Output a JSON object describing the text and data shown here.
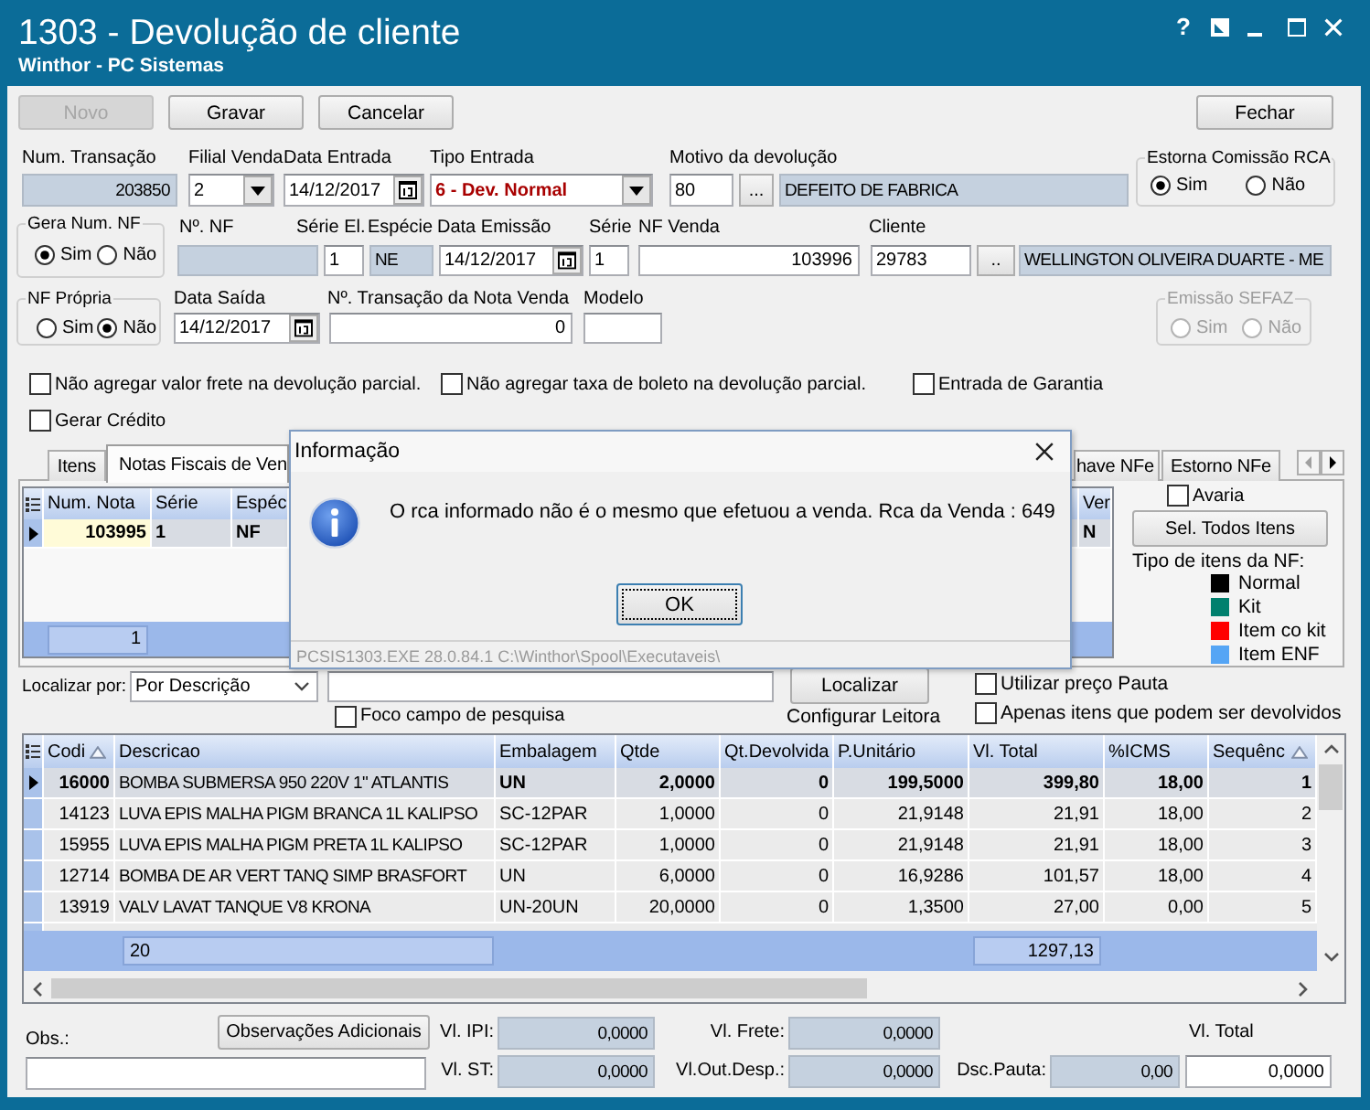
{
  "window": {
    "title": "1303 - Devolução de cliente",
    "subtitle": "Winthor - PC Sistemas",
    "controls": [
      {
        "kind": "help",
        "label": "?"
      },
      {
        "kind": "layout"
      },
      {
        "kind": "minimize"
      },
      {
        "kind": "maximize"
      },
      {
        "kind": "close"
      }
    ]
  },
  "toolbar": [
    {
      "label": "Novo",
      "disabled": true
    },
    {
      "label": "Gravar",
      "disabled": false
    },
    {
      "label": "Cancelar",
      "disabled": false
    },
    {
      "label": "Fechar",
      "disabled": false
    }
  ],
  "form_row_1": [
    {
      "kind": "readonly",
      "label": "Num. Transação",
      "value": "203850"
    },
    {
      "kind": "combo",
      "label": "Filial Venda",
      "value": "2"
    },
    {
      "kind": "date",
      "label": "Data Entrada",
      "value": "14/12/2017"
    },
    {
      "kind": "combo",
      "label": "Tipo Entrada",
      "value": "6 - Dev. Normal"
    },
    {
      "kind": "input",
      "label": "Motivo da devolução",
      "value": "80"
    },
    {
      "kind": "button",
      "value": "..."
    },
    {
      "kind": "readonly",
      "value": "DEFEITO DE FABRICA"
    }
  ],
  "estorna_comissao": {
    "title": "Estorna Comissão RCA",
    "disabled": false,
    "options": [
      {
        "label": "Sim",
        "selected": true
      },
      {
        "label": "Não",
        "selected": false
      }
    ]
  },
  "gera_num_nf": {
    "title": "Gera Num. NF",
    "disabled": false,
    "options": [
      {
        "label": "Sim",
        "selected": true
      },
      {
        "label": "Não",
        "selected": false
      }
    ]
  },
  "form_row_2": [
    {
      "kind": "readonly",
      "label": "Nº. NF"
    },
    {
      "kind": "input",
      "label": "Série El.",
      "value": "1"
    },
    {
      "kind": "readonly",
      "label": "Espécie",
      "value": "NE"
    },
    {
      "kind": "date",
      "label": "Data Emissão",
      "value": "14/12/2017"
    },
    {
      "kind": "input",
      "label": "Série",
      "value": "1"
    },
    {
      "kind": "input",
      "label": "NF Venda",
      "value": "103996"
    },
    {
      "kind": "input",
      "label": "Cliente",
      "value": "29783"
    },
    {
      "kind": "button",
      "value": ".."
    },
    {
      "kind": "readonly",
      "value": "WELLINGTON OLIVEIRA DUARTE - ME"
    }
  ],
  "nf_propria": {
    "title": "NF Própria",
    "disabled": false,
    "options": [
      {
        "label": "Sim",
        "selected": false
      },
      {
        "label": "Não",
        "selected": true
      }
    ]
  },
  "form_row_3": [
    {
      "kind": "date",
      "label": "Data Saída",
      "value": "14/12/2017"
    },
    {
      "kind": "input",
      "label": "Nº. Transação da Nota Venda",
      "value": "0"
    },
    {
      "kind": "input",
      "label": "Modelo"
    }
  ],
  "emissao_sefaz": {
    "title": "Emissão SEFAZ",
    "disabled": true,
    "options": [
      {
        "label": "Sim",
        "selected": false
      },
      {
        "label": "Não",
        "selected": false
      }
    ]
  },
  "checkboxes": [
    {
      "label": "Não agregar valor frete na devolução parcial.",
      "checked": false
    },
    {
      "label": "Não agregar taxa de boleto na devolução parcial.",
      "checked": false
    },
    {
      "label": "Entrada de Garantia",
      "checked": false
    },
    {
      "label": "Gerar Crédito",
      "checked": false
    }
  ],
  "tabs": [
    {
      "label": "Itens",
      "selected": false
    },
    {
      "label": "Notas Fiscais de Ven",
      "selected": true
    },
    {
      "label": "have NFe",
      "selected": false
    },
    {
      "label": "Estorno NFe",
      "selected": false
    }
  ],
  "invoice_grid": {
    "columns": [
      "Num. Nota",
      "Série",
      "Espéc",
      "Ver"
    ],
    "rows": [
      {
        "selected": true,
        "cells": [
          "103995",
          "1",
          "NF",
          "N"
        ]
      }
    ],
    "footer": "1"
  },
  "avaria": {
    "label": "Avaria",
    "checked": false
  },
  "select_all_button": "Sel. Todos Itens",
  "legend": {
    "title": "Tipo de itens da NF:",
    "items": [
      {
        "label": "Normal",
        "color": "#000000"
      },
      {
        "label": "Kit",
        "color": "#00806e"
      },
      {
        "label": "Item co kit",
        "color": "#ff0000"
      },
      {
        "label": "Item ENF",
        "color": "#55a5f5"
      }
    ]
  },
  "search": {
    "label": "Localizar por:",
    "mode": "Por Descrição",
    "button": "Localizar",
    "focus_option": {
      "label": "Foco campo de pesquisa",
      "checked": false
    },
    "reader_link": "Configurar Leitora"
  },
  "filters": [
    {
      "label": "Utilizar preço Pauta",
      "checked": false
    },
    {
      "label": "Apenas itens que podem ser devolvidos",
      "checked": false
    }
  ],
  "items_table": {
    "columns": [
      {
        "label": "Codi",
        "sorted": true
      },
      {
        "label": "Descricao",
        "sorted": false
      },
      {
        "label": "Embalagem",
        "sorted": false
      },
      {
        "label": "Qtde",
        "sorted": false
      },
      {
        "label": "Qt.Devolvida",
        "sorted": false
      },
      {
        "label": "P.Unitário",
        "sorted": false
      },
      {
        "label": "Vl. Total",
        "sorted": false
      },
      {
        "label": "%ICMS",
        "sorted": false
      },
      {
        "label": "Sequênc",
        "sorted": true
      }
    ],
    "rows": [
      {
        "selected": true,
        "cells": [
          "16000",
          "BOMBA SUBMERSA 950 220V 1\" ATLANTIS",
          "UN",
          "2,0000",
          "0",
          "199,5000",
          "399,80",
          "18,00",
          "1"
        ]
      },
      {
        "selected": false,
        "cells": [
          "14123",
          "LUVA EPIS MALHA PIGM BRANCA 1L KALIPSO",
          "SC-12PAR",
          "1,0000",
          "0",
          "21,9148",
          "21,91",
          "18,00",
          "2"
        ]
      },
      {
        "selected": false,
        "cells": [
          "15955",
          "LUVA EPIS MALHA PIGM PRETA 1L KALIPSO",
          "SC-12PAR",
          "1,0000",
          "0",
          "21,9148",
          "21,91",
          "18,00",
          "3"
        ]
      },
      {
        "selected": false,
        "cells": [
          "12714",
          "BOMBA DE AR VERT TANQ SIMP BRASFORT",
          "UN",
          "6,0000",
          "0",
          "16,9286",
          "101,57",
          "18,00",
          "4"
        ]
      },
      {
        "selected": false,
        "cells": [
          "13919",
          "VALV LAVAT TANQUE V8 KRONA",
          "UN-20UN",
          "20,0000",
          "0",
          "1,3500",
          "27,00",
          "0,00",
          "5"
        ]
      }
    ],
    "footer": {
      "count": "20",
      "total": "1297,13"
    }
  },
  "notes_button": "Observações Adicionais",
  "obs": {
    "label": "Obs.:"
  },
  "totals": [
    {
      "label": "Vl. IPI:",
      "value": "0,0000"
    },
    {
      "label": "Vl. Frete:",
      "value": "0,0000"
    },
    {
      "label": "Vl. ST:",
      "value": "0,0000"
    },
    {
      "label": "Vl.Out.Desp.:",
      "value": "0,0000"
    },
    {
      "label": "Dsc.Pauta:",
      "value": "0,00"
    }
  ],
  "grand_total": {
    "label": "Vl. Total",
    "value": "0,0000"
  },
  "dialog": {
    "title": "Informação",
    "message": "O rca informado não é o mesmo que efetuou a venda. Rca da Venda : 649",
    "button": "OK",
    "status": "PCSIS1303.EXE 28.0.84.1 C:\\Winthor\\Spool\\Executaveis\\"
  }
}
